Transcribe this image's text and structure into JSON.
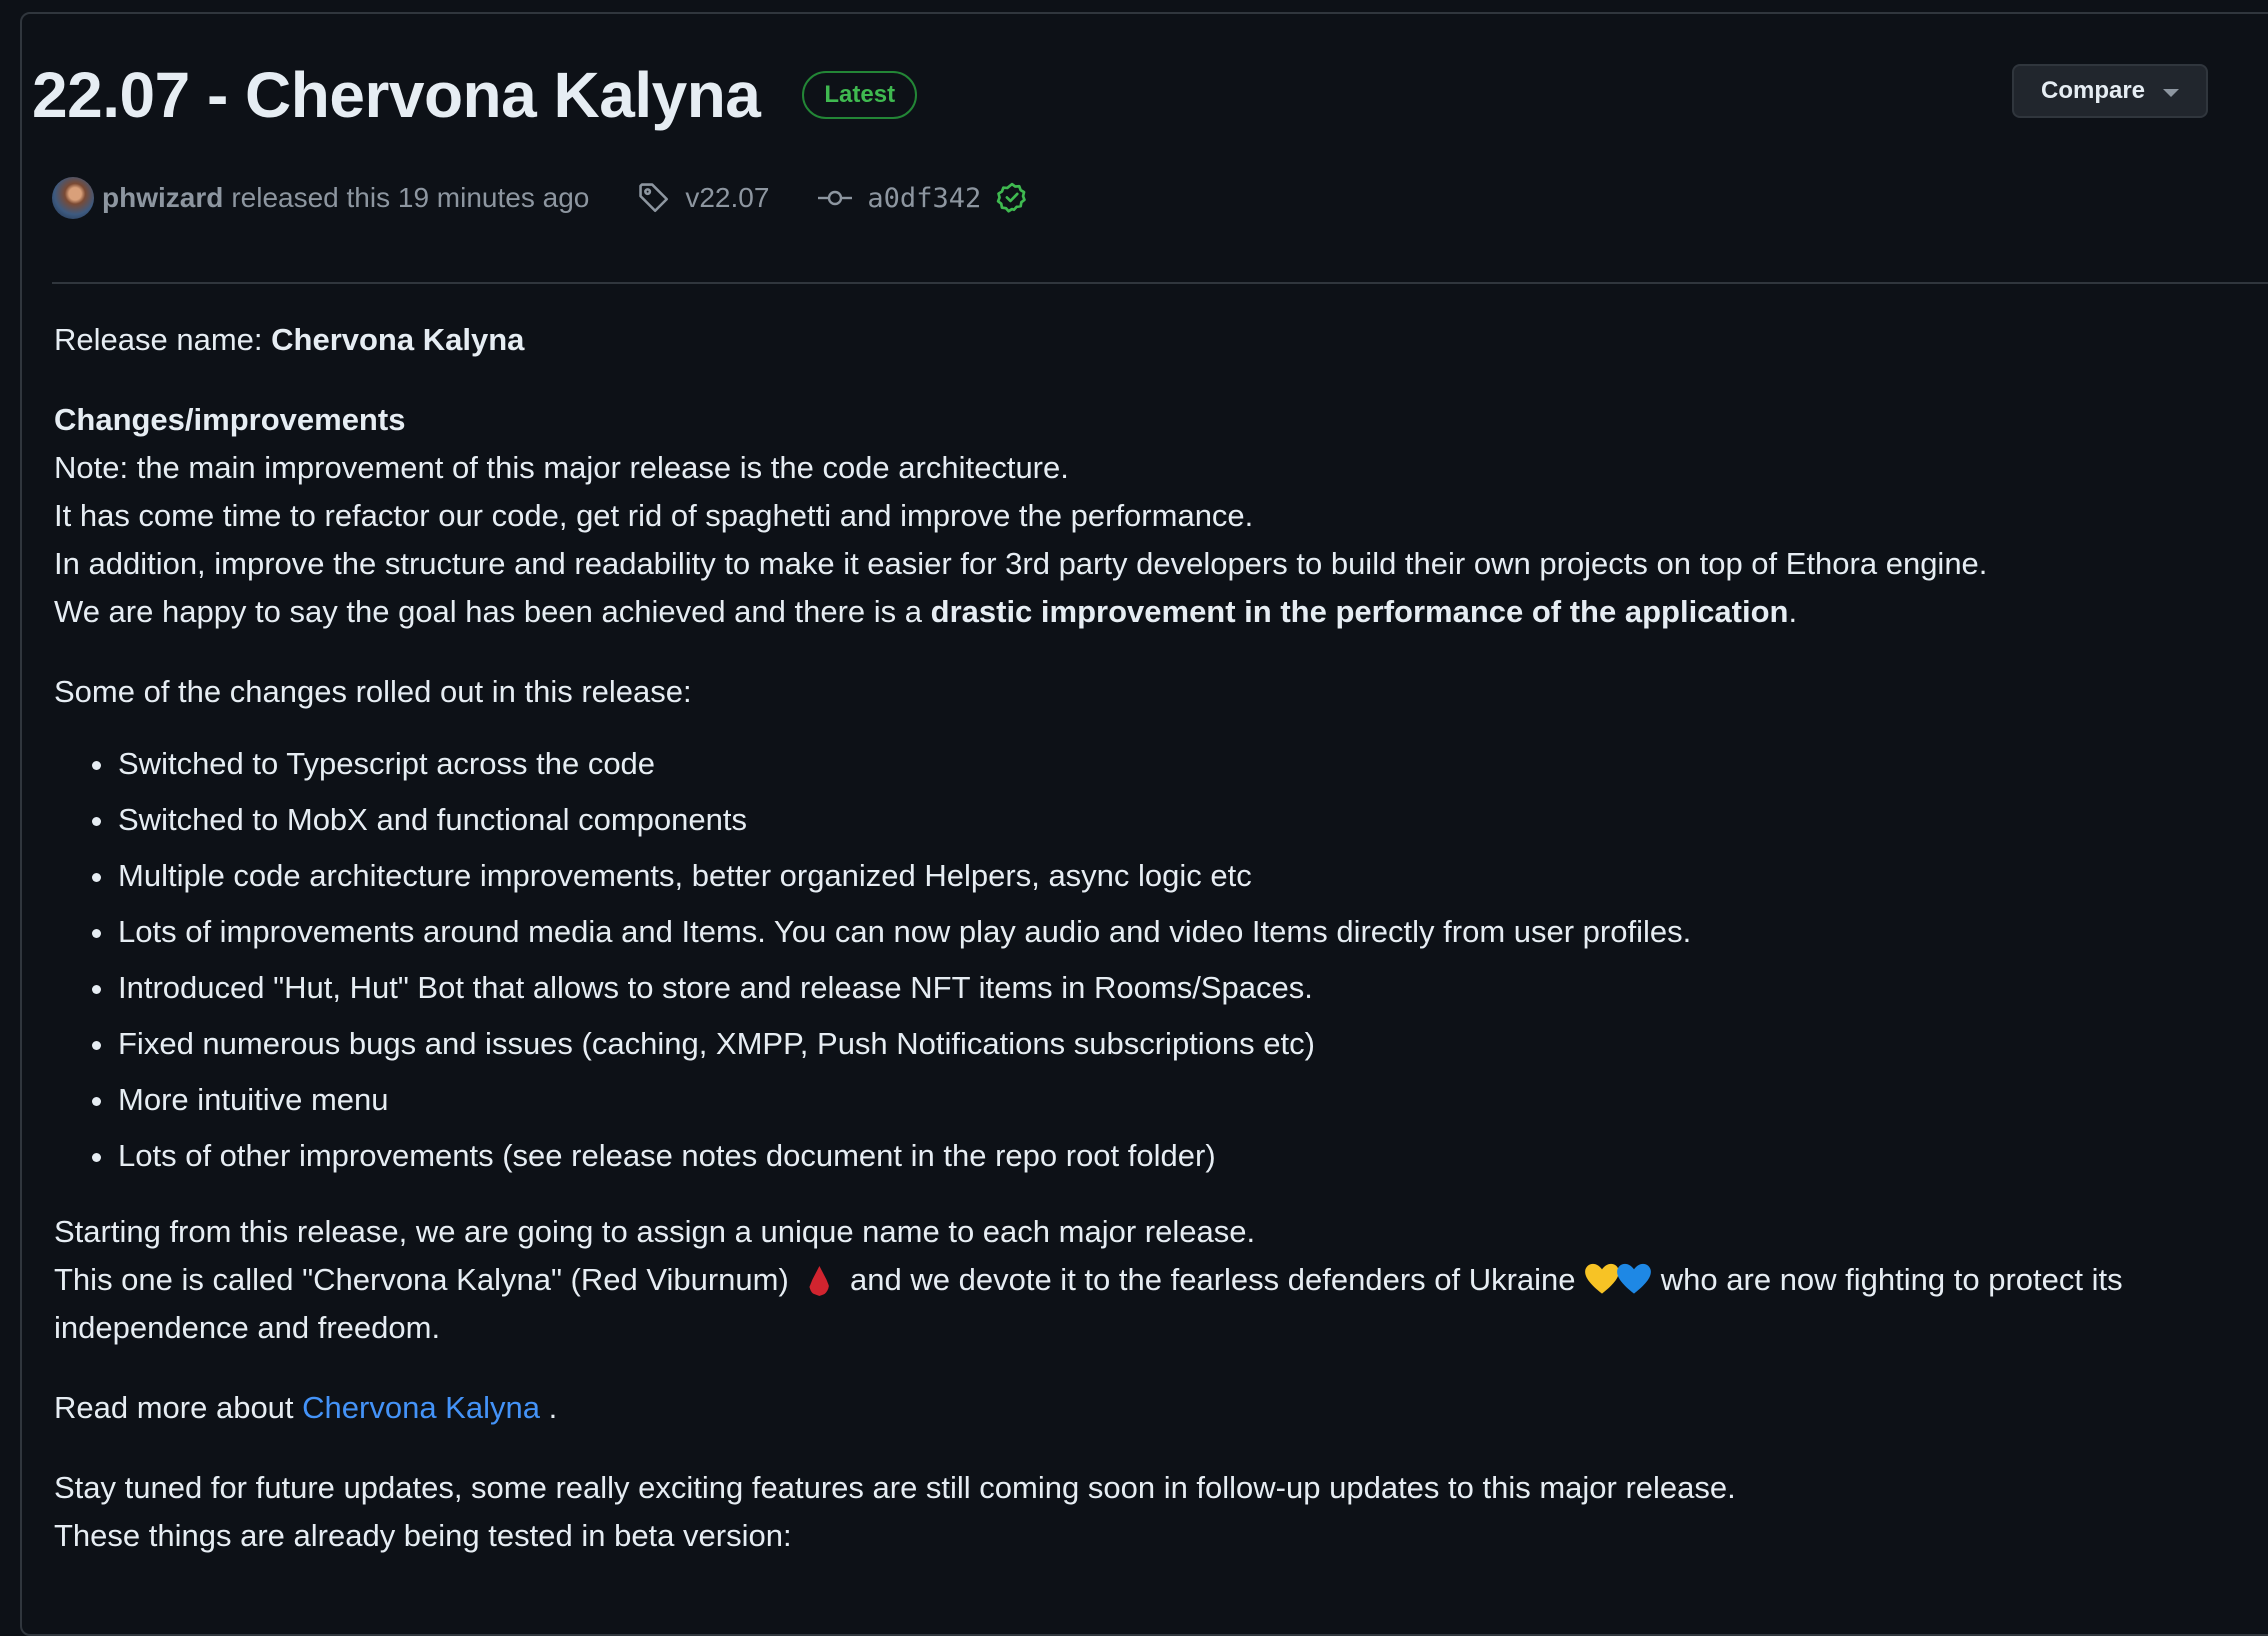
{
  "release": {
    "title": "22.07 - Chervona Kalyna",
    "badge": "Latest",
    "compare_label": "Compare",
    "author": "phwizard",
    "released_text": "released this 19 minutes ago",
    "tag": "v22.07",
    "commit": "a0df342"
  },
  "icons": {
    "tag": "tag-icon",
    "commit": "git-commit-icon",
    "verified": "verified-check-icon",
    "caret": "caret-down-icon"
  },
  "colors": {
    "background": "#0d1117",
    "latest_badge": "#3fb950",
    "link": "#4493f8"
  },
  "notes": {
    "release_name_label": "Release name: ",
    "release_name_value": "Chervona Kalyna",
    "changes_heading": "Changes/improvements",
    "note_line1": "Note: the main improvement of this major release is the code architecture.",
    "note_line2": "It has come time to refactor our code, get rid of spaghetti and improve the performance.",
    "note_line3": "In addition, improve the structure and readability to make it easier for 3rd party developers to build their own projects on top of Ethora engine.",
    "note_line4_prefix": "We are happy to say the goal has been achieved and there is a ",
    "note_line4_bold": "drastic improvement in the performance of the application",
    "note_line4_suffix": ".",
    "changes_intro": "Some of the changes rolled out in this release:",
    "changes": [
      "Switched to Typescript across the code",
      "Switched to MobX and functional components",
      "Multiple code architecture improvements, better organized Helpers, async logic etc",
      "Lots of improvements around media and Items. You can now play audio and video Items directly from user profiles.",
      "Introduced \"Hut, Hut\" Bot that allows to store and release NFT items in Rooms/Spaces.",
      "Fixed numerous bugs and issues (caching, XMPP, Push Notifications subscriptions etc)",
      "More intuitive menu",
      "Lots of other improvements (see release notes document in the repo root folder)"
    ],
    "naming_line1": "Starting from this release, we are going to assign a unique name to each major release.",
    "naming_line2_a": "This one is called \"Chervona Kalyna\" (Red Viburnum)",
    "naming_line2_b": "and we devote it to the fearless defenders of Ukraine",
    "naming_line2_c": "who are now fighting to protect its",
    "naming_line3": "independence and freedom.",
    "read_more_prefix": "Read more about ",
    "read_more_link": "Chervona Kalyna",
    "read_more_suffix": " .",
    "stay_tuned": "Stay tuned for future updates, some really exciting features are still coming soon in follow-up updates to this major release.",
    "beta_line": "These things are already being tested in beta version:"
  }
}
